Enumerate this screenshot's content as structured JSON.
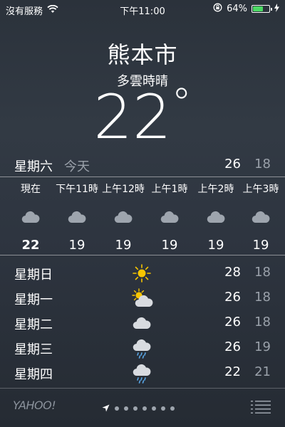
{
  "status": {
    "carrier": "沒有服務",
    "time": "下午11:00",
    "battery_percent": "64%",
    "battery_level": 0.64,
    "battery_color": "#4cd964"
  },
  "location": {
    "city": "熊本市",
    "condition": "多雲時晴",
    "temperature": "22",
    "degree_symbol": "°"
  },
  "today": {
    "day": "星期六",
    "label": "今天",
    "high": "26",
    "low": "18"
  },
  "hourly": [
    {
      "time": "現在",
      "icon": "cloud-icon",
      "temp": "22",
      "bold": true
    },
    {
      "time": "下午11時",
      "icon": "cloud-icon",
      "temp": "19"
    },
    {
      "time": "上午12時",
      "icon": "cloud-icon",
      "temp": "19"
    },
    {
      "time": "上午1時",
      "icon": "cloud-icon",
      "temp": "19"
    },
    {
      "time": "上午2時",
      "icon": "cloud-icon",
      "temp": "19"
    },
    {
      "time": "上午3時",
      "icon": "cloud-icon",
      "temp": "19"
    }
  ],
  "daily": [
    {
      "day": "星期日",
      "icon": "sun-icon",
      "high": "28",
      "low": "18"
    },
    {
      "day": "星期一",
      "icon": "partly-cloudy-icon",
      "high": "26",
      "low": "18"
    },
    {
      "day": "星期二",
      "icon": "cloud-icon",
      "high": "26",
      "low": "18"
    },
    {
      "day": "星期三",
      "icon": "rain-cloud-icon",
      "high": "26",
      "low": "19"
    },
    {
      "day": "星期四",
      "icon": "rain-cloud-icon",
      "high": "22",
      "low": "21"
    }
  ],
  "footer": {
    "logo": "YAHOO!",
    "page_count": 7,
    "current_page": "location-arrow-icon"
  },
  "colors": {
    "secondary_text": "#9aa1aa",
    "sun": "#f7c600"
  }
}
